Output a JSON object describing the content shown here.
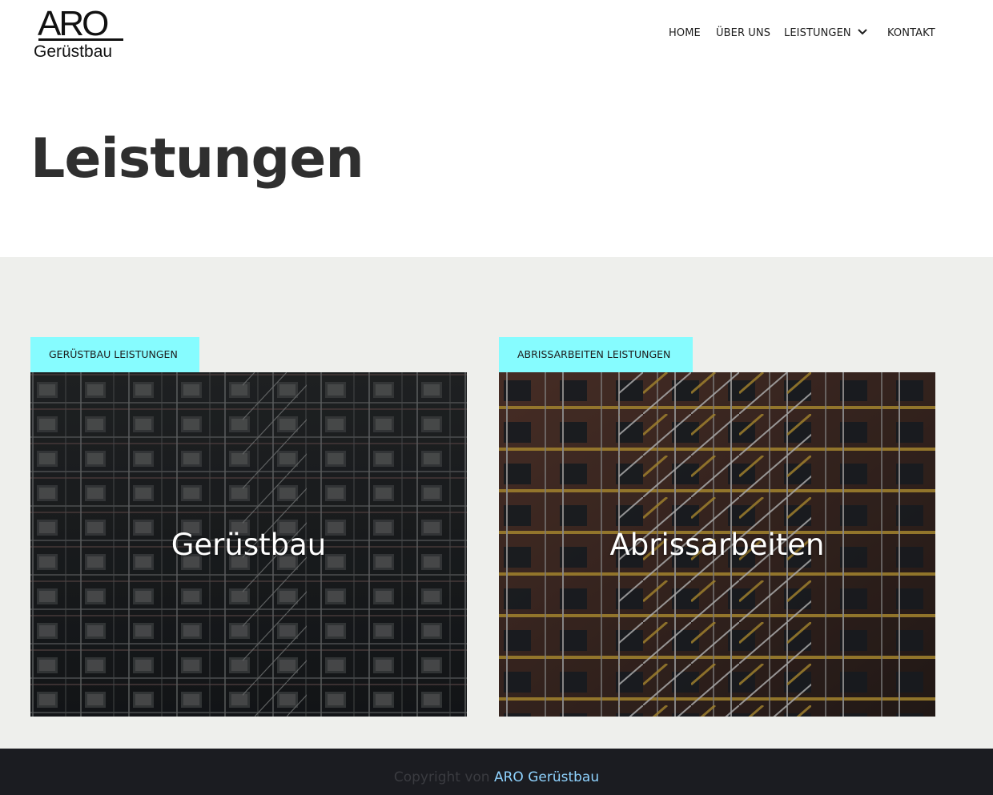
{
  "logo": {
    "main": "ARO",
    "sub": "Gerüstbau"
  },
  "nav": {
    "home": "HOME",
    "about": "ÜBER UNS",
    "services": "LEISTUNGEN",
    "contact": "KONTAKT"
  },
  "page": {
    "title": "Leistungen"
  },
  "cards": [
    {
      "tag": "GERÜSTBAU LEISTUNGEN",
      "title": "Gerüstbau"
    },
    {
      "tag": "ABRISSARBEITEN LEISTUNGEN",
      "title": "Abrissarbeiten"
    }
  ],
  "footer": {
    "prefix": "Copyright von ",
    "brand": "ARO Gerüstbau"
  },
  "colors": {
    "accent": "#86fcff",
    "section_bg": "#eeefec",
    "footer_bg": "#1b1c21",
    "link": "#8fd3ff"
  }
}
